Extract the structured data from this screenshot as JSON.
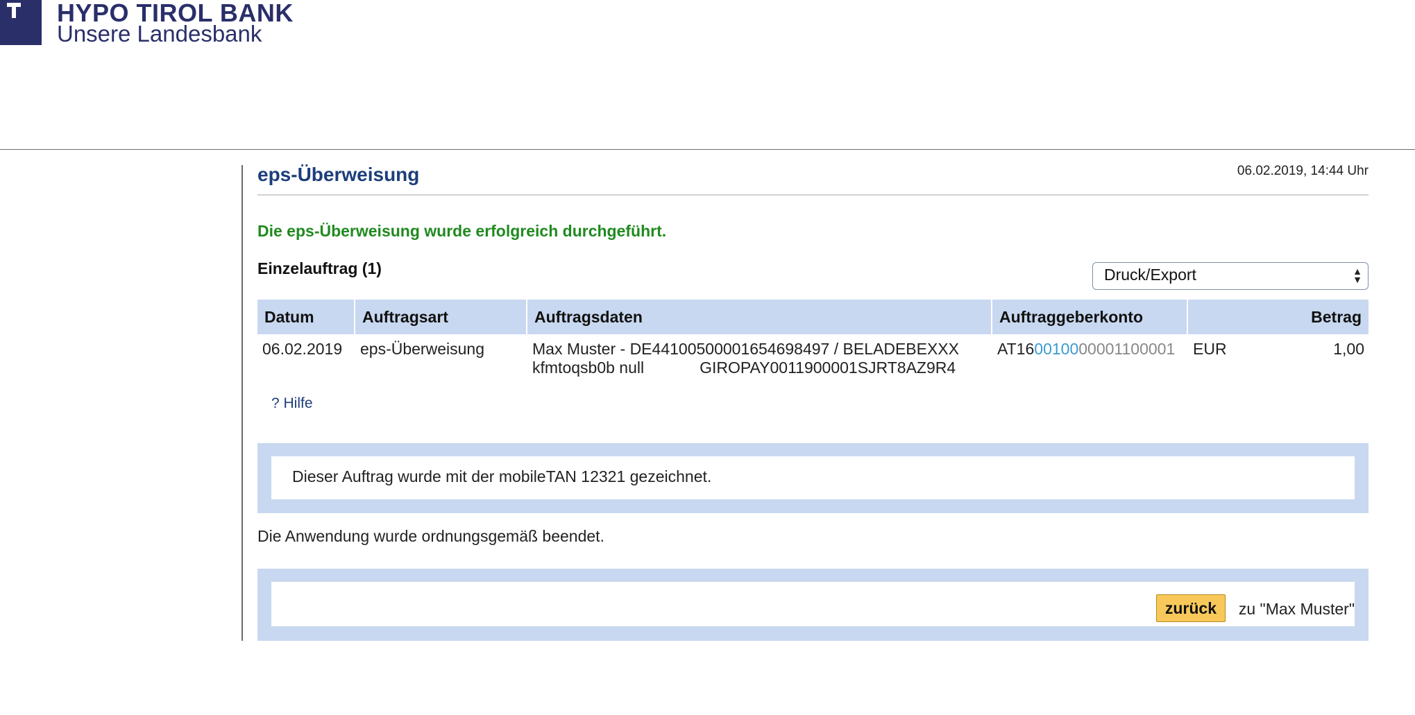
{
  "brand": {
    "name": "HYPO TIROL BANK",
    "tagline": "Unsere Landesbank"
  },
  "page": {
    "title": "eps-Überweisung",
    "timestamp": "06.02.2019, 14:44 Uhr",
    "success_message": "Die eps-Überweisung wurde erfolgreich durchgeführt.",
    "section_title": "Einzelauftrag (1)"
  },
  "export": {
    "selected": "Druck/Export"
  },
  "table": {
    "headers": {
      "date": "Datum",
      "type": "Auftragsart",
      "details": "Auftragsdaten",
      "account": "Auftraggeberkonto",
      "amount": "Betrag"
    },
    "rows": [
      {
        "date": "06.02.2019",
        "type": "eps-Überweisung",
        "details_line1": "Max Muster - DE44100500001654698497 / BELADEBEXXX",
        "details_line2a": "kfmtoqsb0b null",
        "details_line2b": "GIROPAY0011900001SJRT8AZ9R4",
        "account_prefix": "AT16",
        "account_bank": "00100",
        "account_number": "00001100001",
        "currency": "EUR",
        "amount": "1,00"
      }
    ]
  },
  "help": {
    "label": "? Hilfe"
  },
  "signature_panel": {
    "text": "Dieser Auftrag wurde mit der mobileTAN 12321 gezeichnet."
  },
  "finished_message": "Die Anwendung wurde ordnungsgemäß beendet.",
  "navigation": {
    "back_label": "zurück",
    "back_target": "zu \"Max Muster\""
  }
}
